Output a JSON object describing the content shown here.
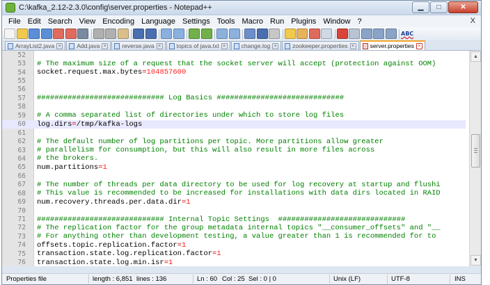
{
  "window": {
    "title": "C:\\kafka_2.12-2.3.0\\config\\server.properties - Notepad++",
    "minimize_glyph": "▁",
    "maximize_glyph": "□",
    "close_glyph": "✕"
  },
  "menu": {
    "items": [
      "File",
      "Edit",
      "Search",
      "View",
      "Encoding",
      "Language",
      "Settings",
      "Tools",
      "Macro",
      "Run",
      "Plugins",
      "Window",
      "?"
    ],
    "close_glyph": "X"
  },
  "toolbar": {
    "icons": [
      "new-file-icon",
      "open-file-icon",
      "save-icon",
      "save-all-icon",
      "close-icon",
      "close-all-icon",
      "print-icon",
      "cut-icon",
      "copy-icon",
      "paste-icon",
      "undo-icon",
      "redo-icon",
      "find-icon",
      "replace-icon",
      "zoom-in-icon",
      "zoom-out-icon",
      "sync-scroll-v-icon",
      "sync-scroll-h-icon",
      "word-wrap-icon",
      "show-all-chars-icon",
      "indent-guide-icon",
      "folder-workspace-icon",
      "document-map-icon",
      "function-list-icon",
      "monitoring-icon",
      "record-macro-icon",
      "stop-macro-icon",
      "play-macro-icon",
      "run-macro-multiple-icon",
      "save-macro-icon",
      "spellcheck-icon"
    ],
    "spell_label": "ABC"
  },
  "tabs": [
    {
      "label": "ArrayList2.java",
      "icon": "blue",
      "active": false
    },
    {
      "label": "Add.java",
      "icon": "blue",
      "active": false
    },
    {
      "label": "reverse.java",
      "icon": "blue",
      "active": false
    },
    {
      "label": "topics of java.txt",
      "icon": "blue",
      "active": false
    },
    {
      "label": "change.log",
      "icon": "blue",
      "active": false
    },
    {
      "label": "zookeeper.properties",
      "icon": "blue",
      "active": false
    },
    {
      "label": "server.properties",
      "icon": "red",
      "active": true
    }
  ],
  "editor": {
    "current_line": "60",
    "lines": [
      {
        "n": "52",
        "parts": []
      },
      {
        "n": "53",
        "parts": [
          {
            "t": "comment",
            "s": "# The maximum size of a request that the socket server will accept (protection against OOM)"
          }
        ]
      },
      {
        "n": "54",
        "parts": [
          {
            "t": "key",
            "s": "socket.request.max.bytes"
          },
          {
            "t": "eq",
            "s": "="
          },
          {
            "t": "num",
            "s": "104857600"
          }
        ]
      },
      {
        "n": "55",
        "parts": []
      },
      {
        "n": "56",
        "parts": []
      },
      {
        "n": "57",
        "parts": [
          {
            "t": "comment",
            "s": "############################# Log Basics #############################"
          }
        ]
      },
      {
        "n": "58",
        "parts": []
      },
      {
        "n": "59",
        "parts": [
          {
            "t": "comment",
            "s": "# A comma separated list of directories under which to store log files"
          }
        ]
      },
      {
        "n": "60",
        "parts": [
          {
            "t": "key",
            "s": "log.dirs"
          },
          {
            "t": "eq",
            "s": "="
          },
          {
            "t": "plain",
            "s": "/tmp/kafka-logs"
          }
        ]
      },
      {
        "n": "61",
        "parts": []
      },
      {
        "n": "62",
        "parts": [
          {
            "t": "comment",
            "s": "# The default number of log partitions per topic. More partitions allow greater"
          }
        ]
      },
      {
        "n": "63",
        "parts": [
          {
            "t": "comment",
            "s": "# parallelism for consumption, but this will also result in more files across"
          }
        ]
      },
      {
        "n": "64",
        "parts": [
          {
            "t": "comment",
            "s": "# the brokers."
          }
        ]
      },
      {
        "n": "65",
        "parts": [
          {
            "t": "key",
            "s": "num.partitions"
          },
          {
            "t": "eq",
            "s": "="
          },
          {
            "t": "num",
            "s": "1"
          }
        ]
      },
      {
        "n": "66",
        "parts": []
      },
      {
        "n": "67",
        "parts": [
          {
            "t": "comment",
            "s": "# The number of threads per data directory to be used for log recovery at startup and flushi"
          }
        ]
      },
      {
        "n": "68",
        "parts": [
          {
            "t": "comment",
            "s": "# This value is recommended to be increased for installations with data dirs located in RAID"
          }
        ]
      },
      {
        "n": "69",
        "parts": [
          {
            "t": "key",
            "s": "num.recovery.threads.per.data.dir"
          },
          {
            "t": "eq",
            "s": "="
          },
          {
            "t": "num",
            "s": "1"
          }
        ]
      },
      {
        "n": "70",
        "parts": []
      },
      {
        "n": "71",
        "parts": [
          {
            "t": "comment",
            "s": "############################# Internal Topic Settings  #############################"
          }
        ]
      },
      {
        "n": "72",
        "parts": [
          {
            "t": "comment",
            "s": "# The replication factor for the group metadata internal topics \"__consumer_offsets\" and \"__"
          }
        ]
      },
      {
        "n": "73",
        "parts": [
          {
            "t": "comment",
            "s": "# For anything other than development testing, a value greater than 1 is recommended for to"
          }
        ]
      },
      {
        "n": "74",
        "parts": [
          {
            "t": "key",
            "s": "offsets.topic.replication.factor"
          },
          {
            "t": "eq",
            "s": "="
          },
          {
            "t": "num",
            "s": "1"
          }
        ]
      },
      {
        "n": "75",
        "parts": [
          {
            "t": "key",
            "s": "transaction.state.log.replication.factor"
          },
          {
            "t": "eq",
            "s": "="
          },
          {
            "t": "num",
            "s": "1"
          }
        ]
      },
      {
        "n": "76",
        "parts": [
          {
            "t": "key",
            "s": "transaction.state.log.min.isr"
          },
          {
            "t": "eq",
            "s": "="
          },
          {
            "t": "num",
            "s": "1"
          }
        ]
      }
    ]
  },
  "status": {
    "file_type": "Properties file",
    "length": "length : 6,851",
    "lines": "lines : 136",
    "ln": "Ln : 60",
    "col": "Col : 25",
    "sel": "Sel : 0 | 0",
    "eol": "Unix (LF)",
    "encoding": "UTF-8",
    "mode": "INS"
  }
}
